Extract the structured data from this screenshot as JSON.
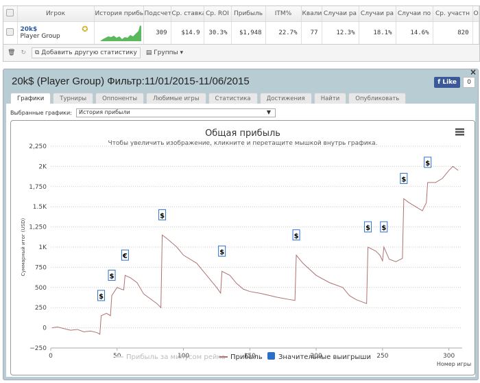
{
  "grid": {
    "headers": [
      "Игрок",
      "История прибыли",
      "Подсчет",
      "Ср. ставка",
      "Ср. ROI",
      "Прибыль",
      "ITM%",
      "Квали",
      "Случаи ра",
      "Случаи ра",
      "Случаи по",
      "Ср. участн",
      "О"
    ],
    "row": {
      "player": "20k$",
      "group": "Player Group",
      "values": [
        "309",
        "$14.9",
        "30.3%",
        "$1,948",
        "22.7%",
        "77",
        "12.3%",
        "18.1%",
        "14.6%",
        "820",
        ""
      ]
    },
    "toolbar": {
      "add_stat": "Добавить другую статистику",
      "groups": "Группы"
    }
  },
  "panel": {
    "title": "20k$ (Player Group) Фильтр:11/01/2015-11/06/2015",
    "like": "Like",
    "like_count": "0",
    "close": "×",
    "tabs": [
      "Графики",
      "Турниры",
      "Оппоненты",
      "Любимые игры",
      "Статистика",
      "Достижения",
      "Найти",
      "Опубликовать"
    ],
    "select_label": "Выбранные графики:",
    "select_value": "История прибыли"
  },
  "chart_data": {
    "type": "line",
    "title": "Общая прибыль",
    "subtitle": "Чтобы увеличить изображение, кликните и перетащите мышкой внутрь графика.",
    "ylabel": "Суммарный итог (USD)",
    "xlabel": "Номер игры",
    "ylim": [
      -250,
      2250
    ],
    "xlim": [
      0,
      310
    ],
    "yticks": [
      {
        "v": 2250,
        "l": "2,250"
      },
      {
        "v": 2000,
        "l": "2K"
      },
      {
        "v": 1750,
        "l": "1,750"
      },
      {
        "v": 1500,
        "l": "1.5K"
      },
      {
        "v": 1250,
        "l": "1,250"
      },
      {
        "v": 1000,
        "l": "1K"
      },
      {
        "v": 750,
        "l": "750"
      },
      {
        "v": 500,
        "l": "500"
      },
      {
        "v": 250,
        "l": "250"
      },
      {
        "v": 0,
        "l": "0"
      },
      {
        "v": -250,
        "l": "−250"
      }
    ],
    "xticks": [
      0,
      50,
      100,
      150,
      200,
      250,
      300
    ],
    "legend": [
      "Прибыль за минусом рейка",
      "Прибыль",
      "Значительные выигрыши"
    ],
    "series": [
      {
        "name": "Прибыль",
        "color": "#b07070",
        "points": [
          [
            1,
            0
          ],
          [
            5,
            10
          ],
          [
            10,
            -10
          ],
          [
            15,
            -30
          ],
          [
            20,
            -20
          ],
          [
            25,
            -50
          ],
          [
            30,
            -40
          ],
          [
            35,
            -60
          ],
          [
            37,
            -80
          ],
          [
            38,
            150
          ],
          [
            42,
            180
          ],
          [
            45,
            150
          ],
          [
            46,
            400
          ],
          [
            50,
            500
          ],
          [
            53,
            480
          ],
          [
            55,
            470
          ],
          [
            56,
            650
          ],
          [
            60,
            620
          ],
          [
            65,
            560
          ],
          [
            70,
            420
          ],
          [
            75,
            360
          ],
          [
            80,
            300
          ],
          [
            83,
            250
          ],
          [
            84,
            1150
          ],
          [
            88,
            1100
          ],
          [
            95,
            1000
          ],
          [
            100,
            900
          ],
          [
            110,
            800
          ],
          [
            115,
            700
          ],
          [
            120,
            600
          ],
          [
            125,
            500
          ],
          [
            128,
            430
          ],
          [
            129,
            700
          ],
          [
            135,
            650
          ],
          [
            140,
            550
          ],
          [
            145,
            480
          ],
          [
            150,
            450
          ],
          [
            160,
            420
          ],
          [
            170,
            380
          ],
          [
            180,
            350
          ],
          [
            184,
            340
          ],
          [
            185,
            900
          ],
          [
            190,
            800
          ],
          [
            200,
            650
          ],
          [
            210,
            560
          ],
          [
            220,
            500
          ],
          [
            225,
            400
          ],
          [
            230,
            350
          ],
          [
            238,
            300
          ],
          [
            239,
            1000
          ],
          [
            245,
            950
          ],
          [
            248,
            900
          ],
          [
            250,
            830
          ],
          [
            251,
            1000
          ],
          [
            255,
            850
          ],
          [
            260,
            820
          ],
          [
            265,
            860
          ],
          [
            266,
            1600
          ],
          [
            270,
            1550
          ],
          [
            275,
            1500
          ],
          [
            280,
            1450
          ],
          [
            283,
            1550
          ],
          [
            284,
            1800
          ],
          [
            290,
            1800
          ],
          [
            295,
            1850
          ],
          [
            300,
            1950
          ],
          [
            303,
            2000
          ],
          [
            307,
            1950
          ]
        ]
      }
    ],
    "markers": [
      {
        "x": 38,
        "y": 150,
        "l": "$"
      },
      {
        "x": 46,
        "y": 400,
        "l": "$"
      },
      {
        "x": 56,
        "y": 650,
        "l": "€"
      },
      {
        "x": 84,
        "y": 1150,
        "l": "$"
      },
      {
        "x": 129,
        "y": 700,
        "l": "$"
      },
      {
        "x": 185,
        "y": 900,
        "l": "$"
      },
      {
        "x": 239,
        "y": 1000,
        "l": "$"
      },
      {
        "x": 251,
        "y": 1000,
        "l": "$"
      },
      {
        "x": 266,
        "y": 1600,
        "l": "$"
      },
      {
        "x": 284,
        "y": 1800,
        "l": "$"
      }
    ]
  }
}
